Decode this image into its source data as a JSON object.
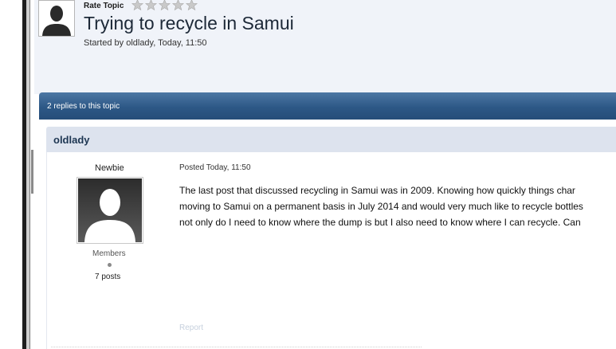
{
  "topic": {
    "rate_label": "Rate Topic",
    "rating": 0,
    "rating_max": 5,
    "title": "Trying to recycle in Samui",
    "meta": "Started by oldlady, Today, 11:50"
  },
  "replies_bar": {
    "text": "2 replies to this topic"
  },
  "post": {
    "author": "oldlady",
    "rank": "Newbie",
    "group": "Members",
    "post_count": "7 posts",
    "posted": "Posted Today, 11:50",
    "body_lines": [
      "The last post that discussed recycling in Samui was in 2009.  Knowing how quickly things char",
      "moving to Samui on a permanent basis in July 2014 and would very much like to recycle bottles",
      "not only do I need to know where the dump is but I also need to know where I can recycle.  Can"
    ],
    "report_label": "Report"
  },
  "colors": {
    "bar_blue": "#2d5886",
    "header_bg": "#f0f3f9",
    "post_header_bg": "#dde3ee",
    "author_blue": "#1d3652"
  },
  "icons": {
    "star": "star-icon",
    "avatar": "default-avatar-icon"
  }
}
